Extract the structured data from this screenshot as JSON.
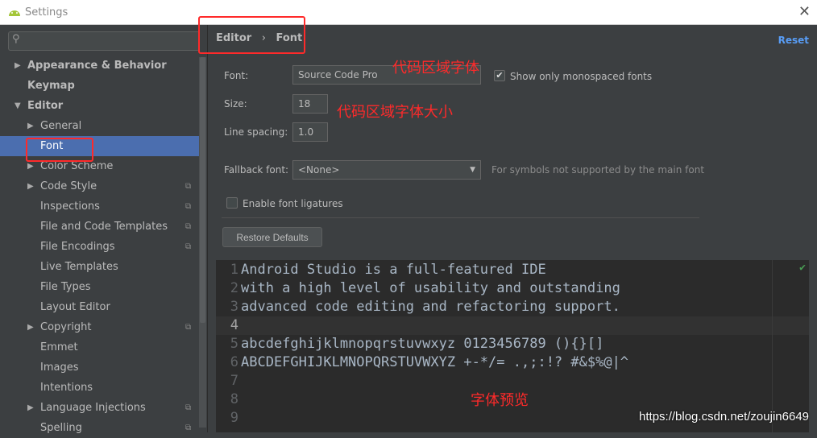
{
  "window": {
    "title": "Settings"
  },
  "sidebar": {
    "items": [
      {
        "label": "Appearance & Behavior",
        "level": 0,
        "arrow": "▶",
        "bold": true
      },
      {
        "label": "Keymap",
        "level": 0,
        "arrow": "",
        "bold": true
      },
      {
        "label": "Editor",
        "level": 0,
        "arrow": "▼",
        "bold": true
      },
      {
        "label": "General",
        "level": 1,
        "arrow": "▶"
      },
      {
        "label": "Font",
        "level": 1,
        "arrow": "",
        "selected": true
      },
      {
        "label": "Color Scheme",
        "level": 1,
        "arrow": "▶"
      },
      {
        "label": "Code Style",
        "level": 1,
        "arrow": "▶",
        "badge": true
      },
      {
        "label": "Inspections",
        "level": 1,
        "arrow": "",
        "badge": true
      },
      {
        "label": "File and Code Templates",
        "level": 1,
        "arrow": "",
        "badge": true
      },
      {
        "label": "File Encodings",
        "level": 1,
        "arrow": "",
        "badge": true
      },
      {
        "label": "Live Templates",
        "level": 1,
        "arrow": ""
      },
      {
        "label": "File Types",
        "level": 1,
        "arrow": ""
      },
      {
        "label": "Layout Editor",
        "level": 1,
        "arrow": ""
      },
      {
        "label": "Copyright",
        "level": 1,
        "arrow": "▶",
        "badge": true
      },
      {
        "label": "Emmet",
        "level": 1,
        "arrow": ""
      },
      {
        "label": "Images",
        "level": 1,
        "arrow": ""
      },
      {
        "label": "Intentions",
        "level": 1,
        "arrow": ""
      },
      {
        "label": "Language Injections",
        "level": 1,
        "arrow": "▶",
        "badge": true
      },
      {
        "label": "Spelling",
        "level": 1,
        "arrow": "",
        "badge": true
      }
    ]
  },
  "breadcrumb": {
    "parent": "Editor",
    "sep": "›",
    "current": "Font"
  },
  "reset_label": "Reset",
  "form": {
    "font_label": "Font:",
    "font_value": "Source Code Pro",
    "mono_label": "Show only monospaced fonts",
    "mono_checked": true,
    "size_label": "Size:",
    "size_value": "18",
    "spacing_label": "Line spacing:",
    "spacing_value": "1.0",
    "fallback_label": "Fallback font:",
    "fallback_value": "<None>",
    "fallback_hint": "For symbols not supported by the main font",
    "ligatures_label": "Enable font ligatures",
    "ligatures_checked": false,
    "restore_label": "Restore Defaults"
  },
  "annotations": {
    "font": "代码区域字体",
    "size": "代码区域字体大小",
    "preview": "字体预览"
  },
  "preview": {
    "lines": [
      "Android Studio is a full-featured IDE",
      "with a high level of usability and outstanding",
      "advanced code editing and refactoring support.",
      "",
      "abcdefghijklmnopqrstuvwxyz 0123456789 (){}[]",
      "ABCDEFGHIJKLMNOPQRSTUVWXYZ +-*/= .,;:!? #&$%@|^",
      "",
      "",
      ""
    ]
  },
  "watermark": "https://blog.csdn.net/zoujin6649"
}
